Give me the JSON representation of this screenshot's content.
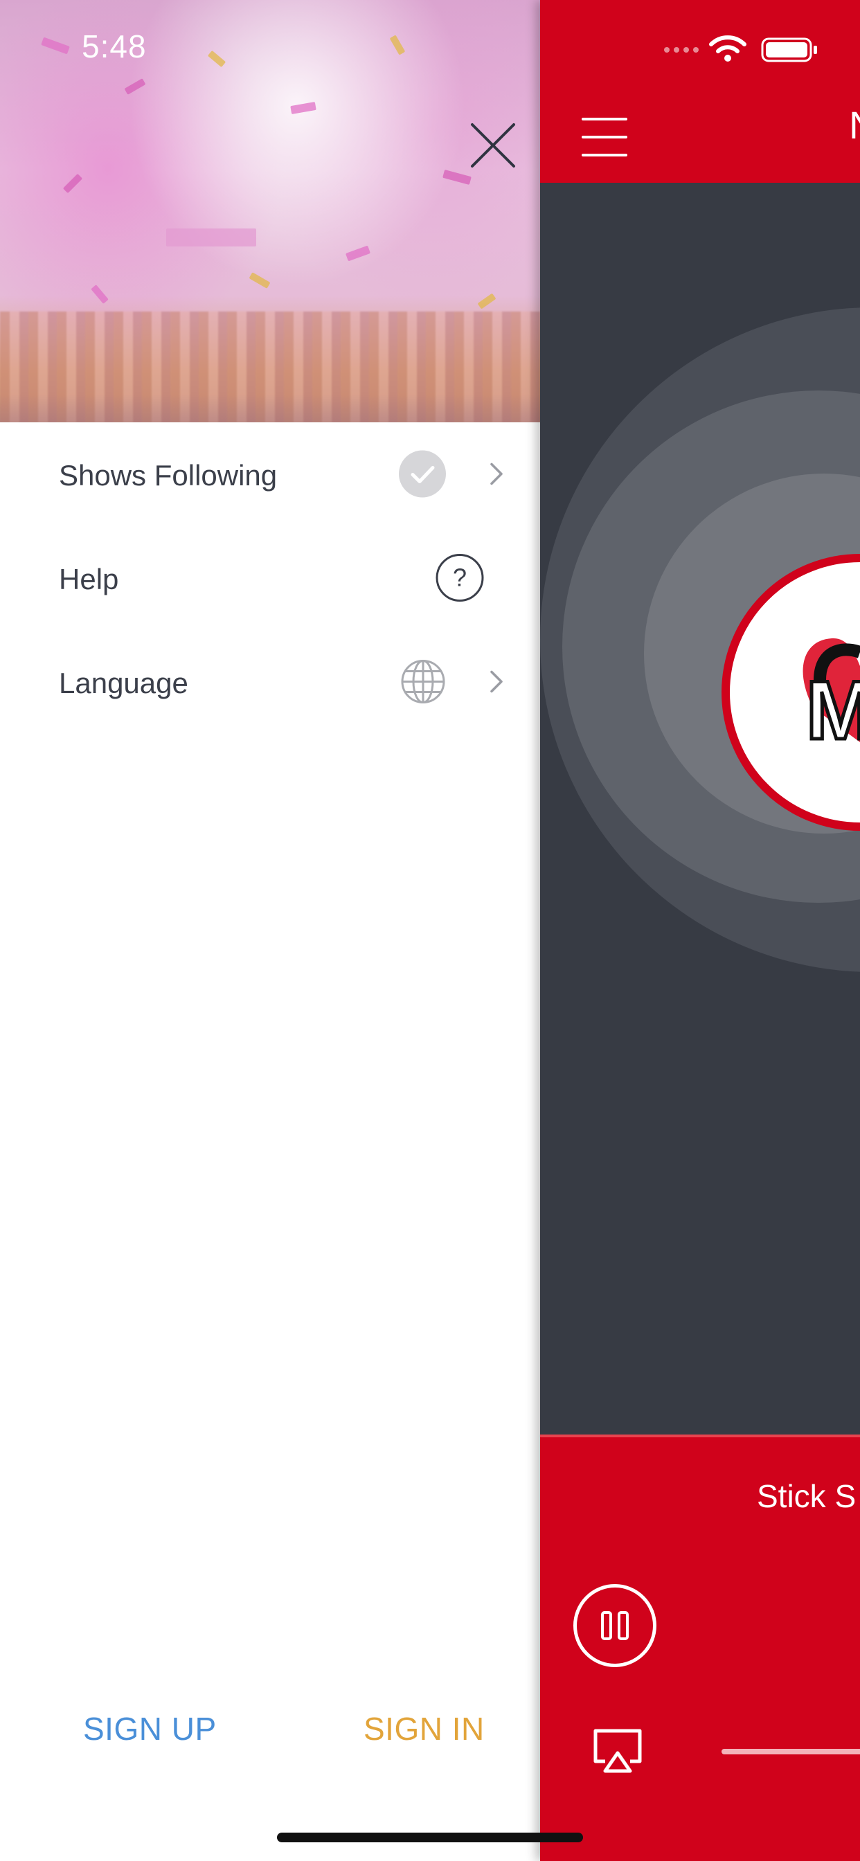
{
  "status_bar": {
    "time": "5:48"
  },
  "drawer": {
    "menu": [
      {
        "label": "Shows Following",
        "icon": "check-circle-icon",
        "has_chevron": true
      },
      {
        "label": "Help",
        "icon": "question-circle-icon",
        "has_chevron": false
      },
      {
        "label": "Language",
        "icon": "globe-icon",
        "has_chevron": true
      }
    ],
    "sign_up": "SIGN UP",
    "sign_in": "SIGN IN"
  },
  "main": {
    "title": "N",
    "logo_text": "M",
    "now_playing": "Stick S"
  },
  "colors": {
    "brand_red": "#d0021b",
    "sign_up": "#4a8fd8",
    "sign_in": "#e2a43a",
    "dark_bg": "#373b44"
  }
}
